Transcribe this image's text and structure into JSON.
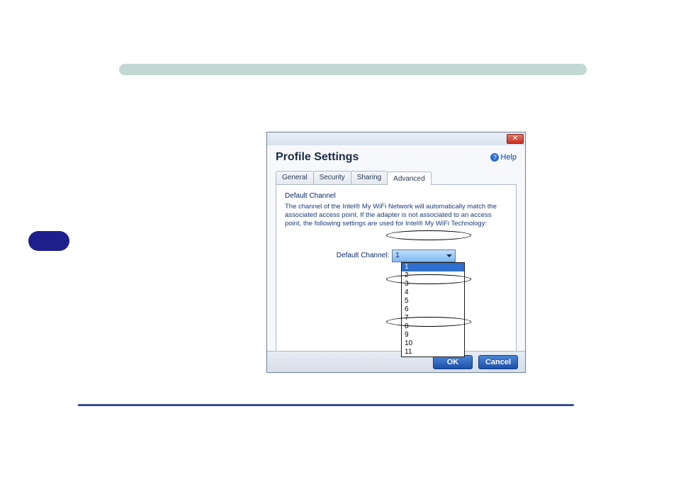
{
  "dialog": {
    "title": "Profile Settings",
    "help_label": "Help",
    "tabs": {
      "general": "General",
      "security": "Security",
      "sharing": "Sharing",
      "advanced": "Advanced"
    },
    "panel": {
      "heading": "Default Channel",
      "description": "The channel of the Intel® My WiFi Network will automatically match the associated access point. If the adapter is not associated to an access point, the following settings are used for Intel® My WiFi Technology:",
      "channel_label": "Default Channel:",
      "selected_value": "1",
      "options": [
        "1",
        "2",
        "3",
        "4",
        "5",
        "6",
        "7",
        "8",
        "9",
        "10",
        "11"
      ]
    },
    "buttons": {
      "ok": "OK",
      "cancel": "Cancel"
    }
  }
}
